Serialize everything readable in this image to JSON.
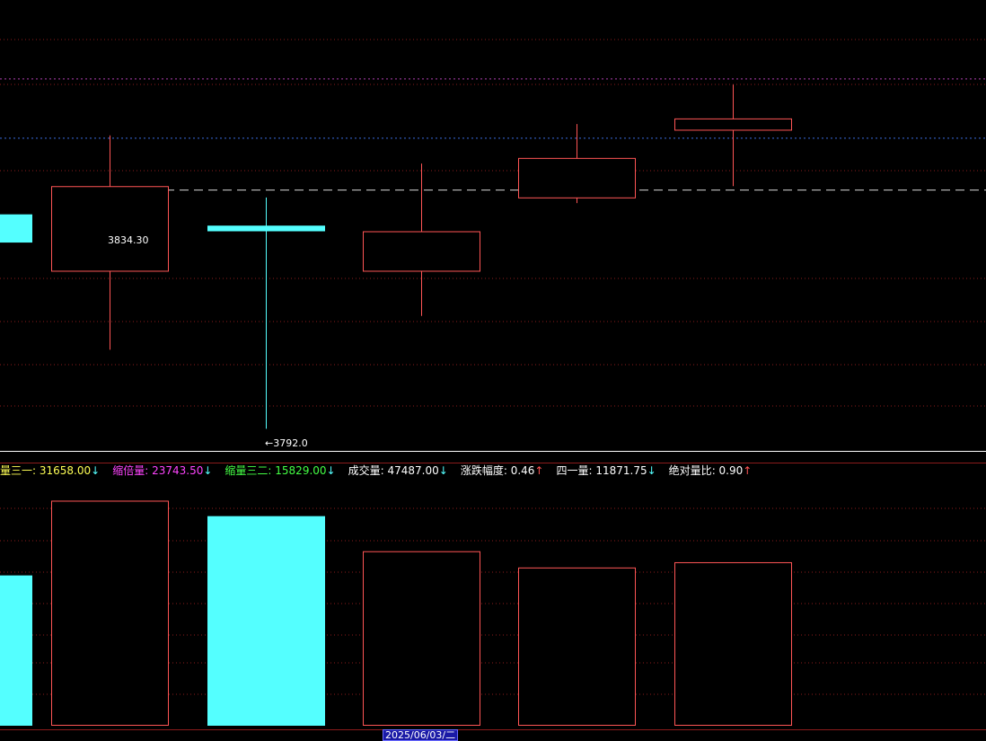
{
  "colors": {
    "background": "#000000",
    "up": "#ff5555",
    "down": "#54ffff",
    "grid": "#8b1c1c",
    "resistance_line": "#b040b0",
    "support_line": "#3b6ee0",
    "dash_line": "#d8d8d8",
    "baseline": "#ffffff"
  },
  "indicators": [
    {
      "label": "缩量三一",
      "value": "31658.00",
      "direction": "down",
      "color": "#ffff55"
    },
    {
      "label": "缩倍量",
      "value": "23743.50",
      "direction": "down",
      "color": "#ff44ff"
    },
    {
      "label": "缩量三二",
      "value": "15829.00",
      "direction": "down",
      "color": "#44ff44"
    },
    {
      "label": "成交量",
      "value": "47487.00",
      "direction": "down",
      "color": "#ffffff"
    },
    {
      "label": "涨跌幅度",
      "value": "0.46",
      "direction": "up",
      "color": "#ffffff"
    },
    {
      "label": "四一量",
      "value": "11871.75",
      "direction": "down",
      "color": "#ffffff"
    },
    {
      "label": "绝对量比",
      "value": "0.90",
      "direction": "up",
      "color": "#ffffff"
    }
  ],
  "arrows": {
    "up": "↑",
    "down": "↓"
  },
  "date_label": "2025/06/03/二",
  "chart_data": [
    {
      "type": "candlestick",
      "name": "price",
      "ylim": [
        3786,
        3868
      ],
      "candles": [
        {
          "open": 3830,
          "close": 3825,
          "high": 3833,
          "low": 3822,
          "dir": "down"
        },
        {
          "open": 3820,
          "close": 3835,
          "high": 3844,
          "low": 3806,
          "dir": "up"
        },
        {
          "open": 3828,
          "close": 3827,
          "high": 3833,
          "low": 3792,
          "dir": "down"
        },
        {
          "open": 3820,
          "close": 3827,
          "high": 3839,
          "low": 3812,
          "dir": "up"
        },
        {
          "open": 3833,
          "close": 3840,
          "high": 3846,
          "low": 3832,
          "dir": "up"
        },
        {
          "open": 3845,
          "close": 3847,
          "high": 3853,
          "low": 3835,
          "dir": "up"
        }
      ],
      "reference_lines": {
        "resistance": 3854,
        "support": 3843.5,
        "dashed": 3834.3,
        "bottom": 3788
      },
      "annotations": {
        "high_label": "3834.30",
        "low_label": "3792.0"
      }
    },
    {
      "type": "bar",
      "name": "volume",
      "ylim": [
        0,
        56000
      ],
      "values": [
        34000,
        51000,
        47487,
        39500,
        35800,
        37000
      ],
      "dirs": [
        "down",
        "up",
        "down",
        "up",
        "up",
        "up"
      ]
    }
  ]
}
